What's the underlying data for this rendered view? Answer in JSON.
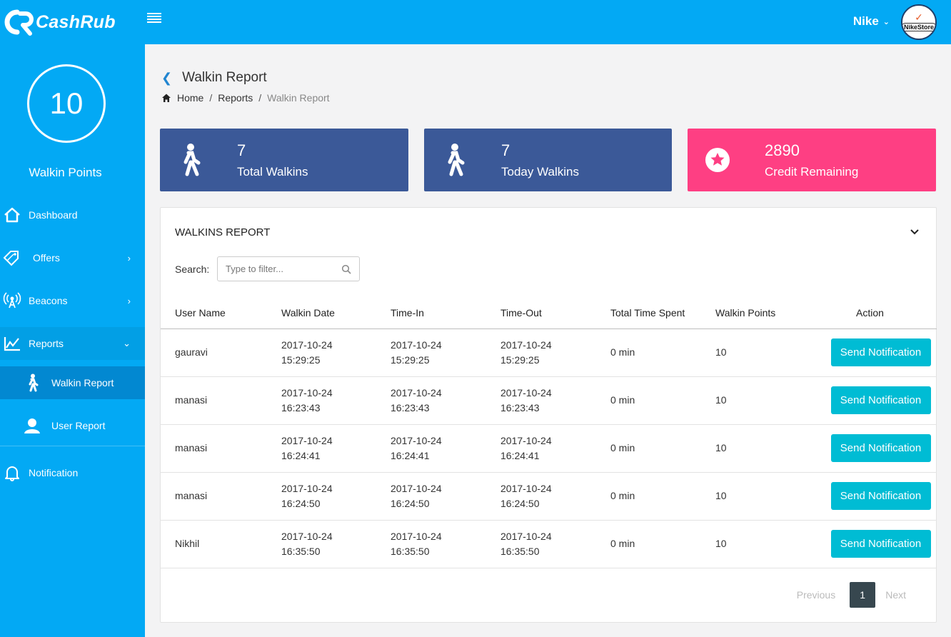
{
  "brand": {
    "name": "CashRub"
  },
  "header": {
    "user_name": "Nike",
    "avatar_text": "NikeStore"
  },
  "sidebar": {
    "points_value": "10",
    "points_label": "Walkin Points",
    "items": [
      {
        "label": "Dashboard"
      },
      {
        "label": "Offers"
      },
      {
        "label": "Beacons"
      },
      {
        "label": "Reports"
      }
    ],
    "sub_items": [
      {
        "label": "Walkin Report"
      },
      {
        "label": "User Report"
      }
    ],
    "notification_label": "Notification"
  },
  "page": {
    "title": "Walkin Report",
    "breadcrumb": {
      "home": "Home",
      "reports": "Reports",
      "current": "Walkin Report",
      "sep": "/"
    }
  },
  "cards": [
    {
      "value": "7",
      "label": "Total Walkins",
      "color": "#3b5998"
    },
    {
      "value": "7",
      "label": "Today Walkins",
      "color": "#3b5998"
    },
    {
      "value": "2890",
      "label": "Credit Remaining",
      "color": "#fe3f83"
    }
  ],
  "report": {
    "title": "WALKINS REPORT",
    "search_label": "Search:",
    "search_placeholder": "Type to filter...",
    "columns": [
      "User Name",
      "Walkin Date",
      "Time-In",
      "Time-Out",
      "Total Time Spent",
      "Walkin Points",
      "Action"
    ],
    "rows": [
      {
        "user": "gauravi",
        "date": "2017-10-24",
        "date_time": "15:29:25",
        "in_date": "2017-10-24",
        "in_time": "15:29:25",
        "out_date": "2017-10-24",
        "out_time": "15:29:25",
        "spent": "0 min",
        "points": "10",
        "action": "Send Notification"
      },
      {
        "user": "manasi",
        "date": "2017-10-24",
        "date_time": "16:23:43",
        "in_date": "2017-10-24",
        "in_time": "16:23:43",
        "out_date": "2017-10-24",
        "out_time": "16:23:43",
        "spent": "0 min",
        "points": "10",
        "action": "Send Notification"
      },
      {
        "user": "manasi",
        "date": "2017-10-24",
        "date_time": "16:24:41",
        "in_date": "2017-10-24",
        "in_time": "16:24:41",
        "out_date": "2017-10-24",
        "out_time": "16:24:41",
        "spent": "0 min",
        "points": "10",
        "action": "Send Notification"
      },
      {
        "user": "manasi",
        "date": "2017-10-24",
        "date_time": "16:24:50",
        "in_date": "2017-10-24",
        "in_time": "16:24:50",
        "out_date": "2017-10-24",
        "out_time": "16:24:50",
        "spent": "0 min",
        "points": "10",
        "action": "Send Notification"
      },
      {
        "user": "Nikhil",
        "date": "2017-10-24",
        "date_time": "16:35:50",
        "in_date": "2017-10-24",
        "in_time": "16:35:50",
        "out_date": "2017-10-24",
        "out_time": "16:35:50",
        "spent": "0 min",
        "points": "10",
        "action": "Send Notification"
      }
    ],
    "pagination": {
      "previous": "Previous",
      "current_page": "1",
      "next": "Next"
    }
  },
  "colors": {
    "primary": "#03a9f4",
    "card_blue": "#3b5998",
    "card_pink": "#fe3f83",
    "action_button": "#00bcd4",
    "pager_active": "#37474f"
  }
}
